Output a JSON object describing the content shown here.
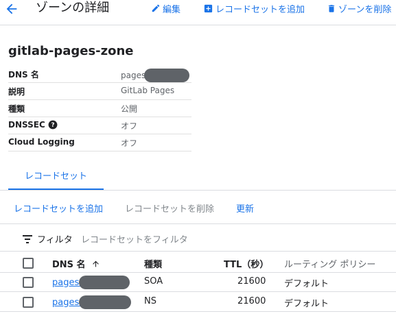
{
  "header": {
    "title": "ゾーンの詳細",
    "edit_label": "編集",
    "add_recordset_label": "レコードセットを追加",
    "delete_zone_label": "ゾーンを削除"
  },
  "zone": {
    "name": "gitlab-pages-zone"
  },
  "details": [
    {
      "label": "DNS 名",
      "value": "pages."
    },
    {
      "label": "説明",
      "value": "GitLab Pages"
    },
    {
      "label": "種類",
      "value": "公開"
    },
    {
      "label": "DNSSEC",
      "value": "オフ",
      "help_icon": "help-icon"
    },
    {
      "label": "Cloud Logging",
      "value": "オフ"
    }
  ],
  "tabs": [
    {
      "label": "レコードセット",
      "active": true
    }
  ],
  "actions": {
    "add_recordset": "レコードセットを追加",
    "delete_recordset": "レコードセットを削除",
    "refresh": "更新"
  },
  "filter": {
    "label": "フィルタ",
    "placeholder": "レコードセットをフィルタ"
  },
  "table": {
    "columns": {
      "dns_name": "DNS 名",
      "type": "種類",
      "ttl": "TTL（秒）",
      "routing_policy": "ルーティング ポリシー"
    },
    "sort": {
      "column": "dns_name",
      "direction": "ascending"
    },
    "rows": [
      {
        "dns_name": "pages.",
        "type": "SOA",
        "ttl": "21600",
        "routing_policy": "デフォルト"
      },
      {
        "dns_name": "pages.",
        "type": "NS",
        "ttl": "21600",
        "routing_policy": "デフォルト"
      }
    ]
  },
  "colors": {
    "accent": "#1a73e8",
    "text": "#202124",
    "secondary_text": "#5f6368",
    "disabled_text": "#80868b",
    "divider": "#dadce0",
    "redaction": "#5f6368"
  },
  "icons": [
    "back-arrow-icon",
    "pencil-icon",
    "plus-box-icon",
    "trash-icon",
    "help-icon",
    "filter-icon",
    "sort-arrow-up-icon"
  ]
}
